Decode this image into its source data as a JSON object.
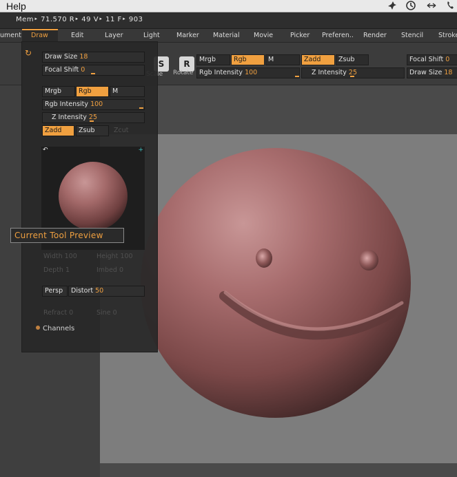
{
  "help_bar": {
    "menu": "Help"
  },
  "status": {
    "stats": "Mem‣ 71.570  R‣ 49  V‣ 11  F‣ 903"
  },
  "menu": {
    "items": [
      "ument",
      "Draw",
      "Edit",
      "Layer",
      "Light",
      "Marker",
      "Material",
      "Movie",
      "Picker",
      "Preferen..",
      "Render",
      "Stencil",
      "Stroke"
    ]
  },
  "shelf": {
    "scale_label": "Scale",
    "rotate_label": "Rotate",
    "mrgb": "Mrgb",
    "rgb": "Rgb",
    "m": "M",
    "zadd": "Zadd",
    "zsub": "Zsub",
    "rgb_intensity_label": "Rgb Intensity",
    "rgb_intensity_value": "100",
    "z_intensity_label": "Z Intensity",
    "z_intensity_value": "25",
    "focal_shift_label": "Focal Shift",
    "focal_shift_value": "0",
    "draw_size_label": "Draw Size",
    "draw_size_value": "18"
  },
  "draw_panel": {
    "draw_size_label": "Draw Size",
    "draw_size_value": "18",
    "focal_shift_label": "Focal Shift",
    "focal_shift_value": "0",
    "mrgb": "Mrgb",
    "rgb": "Rgb",
    "m": "M",
    "rgb_intensity_label": "Rgb Intensity",
    "rgb_intensity_value": "100",
    "z_intensity_label": "Z Intensity",
    "z_intensity_value": "25",
    "zadd": "Zadd",
    "zsub": "Zsub",
    "zcut": "Zcut",
    "width_label": "Width",
    "width_value": "100",
    "height_label": "Height",
    "height_value": "100",
    "depth_label": "Depth",
    "depth_value": "1",
    "imbed_label": "Imbed",
    "imbed_value": "0",
    "persp": "Persp",
    "distort_label": "Distort",
    "distort_value": "50",
    "refract_label": "Refract",
    "refract_value": "0",
    "sine_label": "Sine",
    "sine_value": "0",
    "channels": "Channels"
  },
  "tooltip": {
    "text": "Current Tool Preview"
  },
  "colors": {
    "accent": "#f0a040",
    "clay": "#a86d6e",
    "canvas": "#7d7d7d"
  }
}
